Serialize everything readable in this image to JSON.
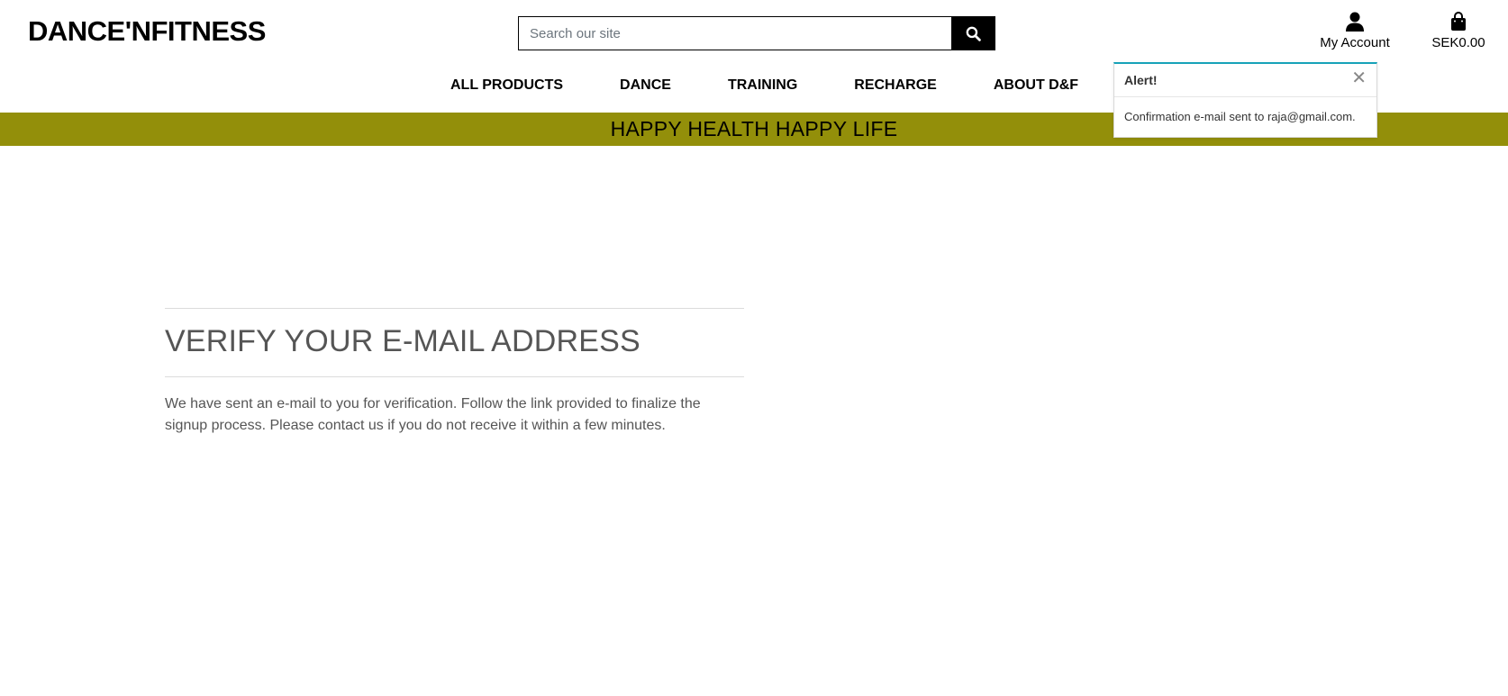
{
  "header": {
    "logo": "DANCE'NFITNESS",
    "search": {
      "placeholder": "Search our site",
      "value": ""
    },
    "account": {
      "label": "My Account",
      "icon": "user-icon"
    },
    "bag": {
      "label": "SEK0.00",
      "icon": "shopping-bag-icon"
    }
  },
  "nav": {
    "items": [
      {
        "label": "ALL PRODUCTS"
      },
      {
        "label": "DANCE"
      },
      {
        "label": "TRAINING"
      },
      {
        "label": "RECHARGE"
      },
      {
        "label": "ABOUT D&F"
      }
    ]
  },
  "banner": {
    "text": "HAPPY HEALTH HAPPY LIFE",
    "color": "#938f0a"
  },
  "toast": {
    "title": "Alert!",
    "message": "Confirmation e-mail sent to raja@gmail.com.",
    "accent": "#17a2b8"
  },
  "main": {
    "title": "VERIFY YOUR E-MAIL ADDRESS",
    "text": "We have sent an e-mail to you for verification. Follow the link provided to finalize the signup process. Please contact us if you do not receive it within a few minutes."
  }
}
